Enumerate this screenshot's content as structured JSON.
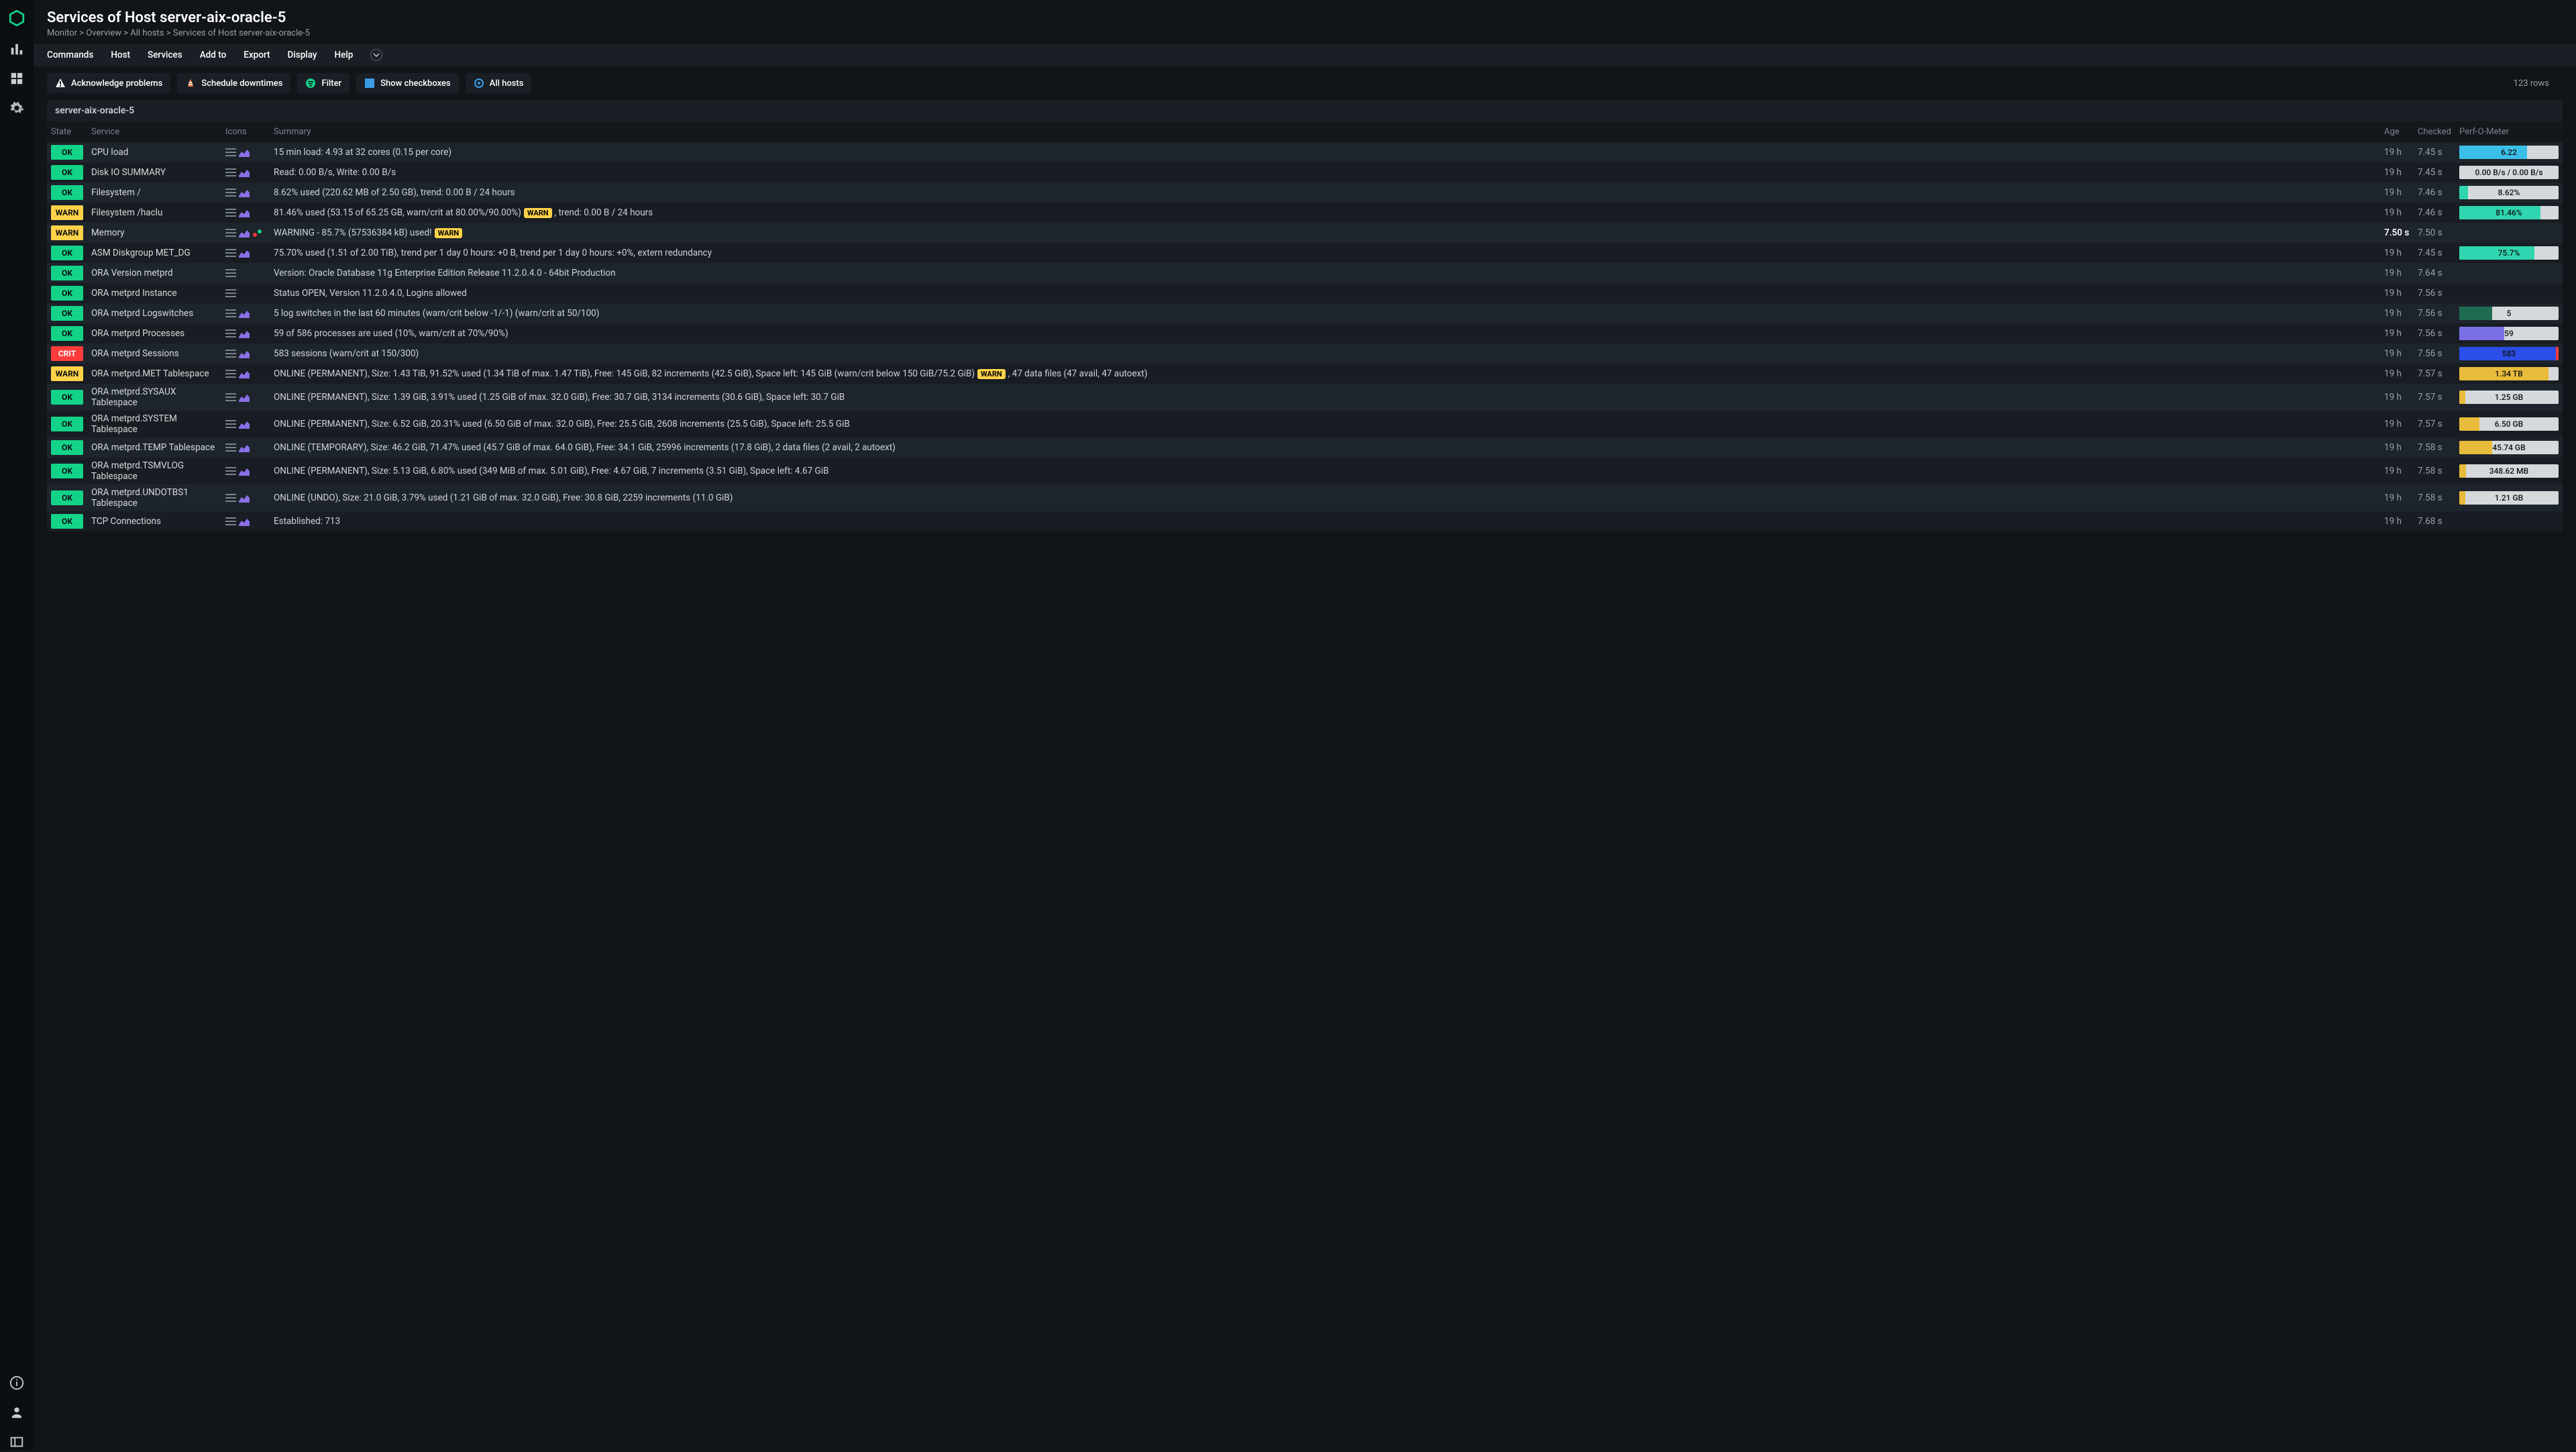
{
  "title": "Services of Host server-aix-oracle-5",
  "breadcrumb": "Monitor > Overview > All hosts > Services of Host server-aix-oracle-5",
  "menubar": [
    "Commands",
    "Host",
    "Services",
    "Add to",
    "Export",
    "Display",
    "Help"
  ],
  "toolbar": {
    "ack": "Acknowledge problems",
    "down": "Schedule downtimes",
    "filter": "Filter",
    "checkboxes": "Show checkboxes",
    "allhosts": "All hosts"
  },
  "rowcount": "123 rows",
  "hostname": "server-aix-oracle-5",
  "columns": {
    "state": "State",
    "service": "Service",
    "icons": "Icons",
    "summary": "Summary",
    "age": "Age",
    "checked": "Checked",
    "perf": "Perf-O-Meter"
  },
  "rows": [
    {
      "state": "OK",
      "service": "CPU load",
      "icons": [
        "menu",
        "graph"
      ],
      "summary": "15 min load: 4.93 at 32 cores (0.15 per core)",
      "age": "19 h",
      "checked": "7.45 s",
      "perf": {
        "label": "6.22",
        "segments": [
          {
            "color": "#3bbfe8",
            "w": 68
          }
        ]
      }
    },
    {
      "state": "OK",
      "service": "Disk IO SUMMARY",
      "icons": [
        "menu",
        "graph"
      ],
      "summary": "Read: 0.00 B/s, Write: 0.00 B/s",
      "age": "19 h",
      "checked": "7.45 s",
      "perf": {
        "label": "0.00 B/s / 0.00 B/s",
        "segments": []
      }
    },
    {
      "state": "OK",
      "service": "Filesystem /",
      "icons": [
        "menu",
        "graph"
      ],
      "summary": "8.62% used (220.62 MB of 2.50 GB), trend: 0.00 B / 24 hours",
      "age": "19 h",
      "checked": "7.46 s",
      "perf": {
        "label": "8.62%",
        "segments": [
          {
            "color": "#2fd6b0",
            "w": 8.6
          }
        ]
      }
    },
    {
      "state": "WARN",
      "service": "Filesystem /haclu",
      "icons": [
        "menu",
        "graph"
      ],
      "summary_parts": [
        "81.46% used (53.15 of 65.25 GB, warn/crit at 80.00%/90.00%)",
        "WARN",
        ", trend: 0.00 B / 24 hours"
      ],
      "age": "19 h",
      "checked": "7.46 s",
      "perf": {
        "label": "81.46%",
        "segments": [
          {
            "color": "#2fd6b0",
            "w": 81.5
          }
        ]
      }
    },
    {
      "state": "WARN",
      "service": "Memory",
      "icons": [
        "menu",
        "graph",
        "dots"
      ],
      "summary_parts": [
        "WARNING - 85.7% (57536384 kB) used!",
        "WARN"
      ],
      "age": "7.50 s",
      "age_bold": true,
      "checked": "7.50 s"
    },
    {
      "state": "OK",
      "service": "ASM Diskgroup MET_DG",
      "icons": [
        "menu",
        "graph"
      ],
      "summary": "75.70% used (1.51 of 2.00 TiB), trend per 1 day 0 hours: +0 B, trend per 1 day 0 hours: +0%, extern redundancy",
      "age": "19 h",
      "checked": "7.45 s",
      "perf": {
        "label": "75.7%",
        "segments": [
          {
            "color": "#2fd6b0",
            "w": 75.7
          }
        ]
      }
    },
    {
      "state": "OK",
      "service": "ORA Version metprd",
      "icons": [
        "menu"
      ],
      "summary": "Version: Oracle Database 11g Enterprise Edition Release 11.2.0.4.0 - 64bit Production",
      "age": "19 h",
      "checked": "7.64 s"
    },
    {
      "state": "OK",
      "service": "ORA metprd Instance",
      "icons": [
        "menu"
      ],
      "summary": "Status OPEN, Version 11.2.0.4.0, Logins allowed",
      "age": "19 h",
      "checked": "7.56 s"
    },
    {
      "state": "OK",
      "service": "ORA metprd Logswitches",
      "icons": [
        "menu",
        "graph"
      ],
      "summary": "5 log switches in the last 60 minutes (warn/crit below -1/-1) (warn/crit at 50/100)",
      "age": "19 h",
      "checked": "7.56 s",
      "perf": {
        "label": "5",
        "segments": [
          {
            "color": "#1f6b52",
            "w": 33
          }
        ]
      }
    },
    {
      "state": "OK",
      "service": "ORA metprd Processes",
      "icons": [
        "menu",
        "graph"
      ],
      "summary": "59 of 586 processes are used (10%, warn/crit at 70%/90%)",
      "age": "19 h",
      "checked": "7.56 s",
      "perf": {
        "label": "59",
        "segments": [
          {
            "color": "#7b6fe6",
            "w": 45
          }
        ]
      }
    },
    {
      "state": "CRIT",
      "service": "ORA metprd Sessions",
      "icons": [
        "menu",
        "graph"
      ],
      "summary": "583 sessions (warn/crit at 150/300)",
      "age": "19 h",
      "checked": "7.56 s",
      "perf": {
        "label": "583",
        "segments": [
          {
            "color": "#2b4de8",
            "w": 97
          }
        ],
        "tail": "#ff3b3b"
      }
    },
    {
      "state": "WARN",
      "service": "ORA metprd.MET Tablespace",
      "icons": [
        "menu",
        "graph"
      ],
      "summary_parts": [
        "ONLINE (PERMANENT), Size: 1.43 TiB, 91.52% used (1.34 TiB of max. 1.47 TiB), Free: 145 GiB, 82 increments (42.5 GiB), Space left: 145 GiB (warn/crit below 150 GiB/75.2 GiB)",
        "WARN",
        ", 47 data files (47 avail, 47 autoext)"
      ],
      "age": "19 h",
      "checked": "7.57 s",
      "perf": {
        "label": "1.34 TB",
        "segments": [
          {
            "color": "#e8bb3a",
            "w": 90
          }
        ]
      }
    },
    {
      "state": "OK",
      "service": "ORA metprd.SYSAUX Tablespace",
      "icons": [
        "menu",
        "graph"
      ],
      "summary": "ONLINE (PERMANENT), Size: 1.39 GiB, 3.91% used (1.25 GiB of max. 32.0 GiB), Free: 30.7 GiB, 3134 increments (30.6 GiB), Space left: 30.7 GiB",
      "age": "19 h",
      "checked": "7.57 s",
      "perf": {
        "label": "1.25 GB",
        "segments": [
          {
            "color": "#e8bb3a",
            "w": 6
          }
        ]
      }
    },
    {
      "state": "OK",
      "service": "ORA metprd.SYSTEM Tablespace",
      "icons": [
        "menu",
        "graph"
      ],
      "summary": "ONLINE (PERMANENT), Size: 6.52 GiB, 20.31% used (6.50 GiB of max. 32.0 GiB), Free: 25.5 GiB, 2608 increments (25.5 GiB), Space left: 25.5 GiB",
      "age": "19 h",
      "checked": "7.57 s",
      "perf": {
        "label": "6.50 GB",
        "segments": [
          {
            "color": "#e8bb3a",
            "w": 20
          }
        ]
      }
    },
    {
      "state": "OK",
      "service": "ORA metprd.TEMP Tablespace",
      "icons": [
        "menu",
        "graph"
      ],
      "summary": "ONLINE (TEMPORARY), Size: 46.2 GiB, 71.47% used (45.7 GiB of max. 64.0 GiB), Free: 34.1 GiB, 25996 increments (17.8 GiB), 2 data files (2 avail, 2 autoext)",
      "age": "19 h",
      "checked": "7.58 s",
      "perf": {
        "label": "45.74 GB",
        "segments": [
          {
            "color": "#e8bb3a",
            "w": 33
          }
        ]
      }
    },
    {
      "state": "OK",
      "service": "ORA metprd.TSMVLOG Tablespace",
      "icons": [
        "menu",
        "graph"
      ],
      "summary": "ONLINE (PERMANENT), Size: 5.13 GiB, 6.80% used (349 MiB of max. 5.01 GiB), Free: 4.67 GiB, 7 increments (3.51 GiB), Space left: 4.67 GiB",
      "age": "19 h",
      "checked": "7.58 s",
      "perf": {
        "label": "348.62 MB",
        "segments": [
          {
            "color": "#e8bb3a",
            "w": 7
          }
        ]
      }
    },
    {
      "state": "OK",
      "service": "ORA metprd.UNDOTBS1 Tablespace",
      "icons": [
        "menu",
        "graph"
      ],
      "summary": "ONLINE (UNDO), Size: 21.0 GiB, 3.79% used (1.21 GiB of max. 32.0 GiB), Free: 30.8 GiB, 2259 increments (11.0 GiB)",
      "age": "19 h",
      "checked": "7.58 s",
      "perf": {
        "label": "1.21 GB",
        "segments": [
          {
            "color": "#e8bb3a",
            "w": 6
          }
        ]
      }
    },
    {
      "state": "OK",
      "service": "TCP Connections",
      "icons": [
        "menu",
        "graph"
      ],
      "summary": "Established: 713",
      "age": "19 h",
      "checked": "7.68 s"
    }
  ]
}
